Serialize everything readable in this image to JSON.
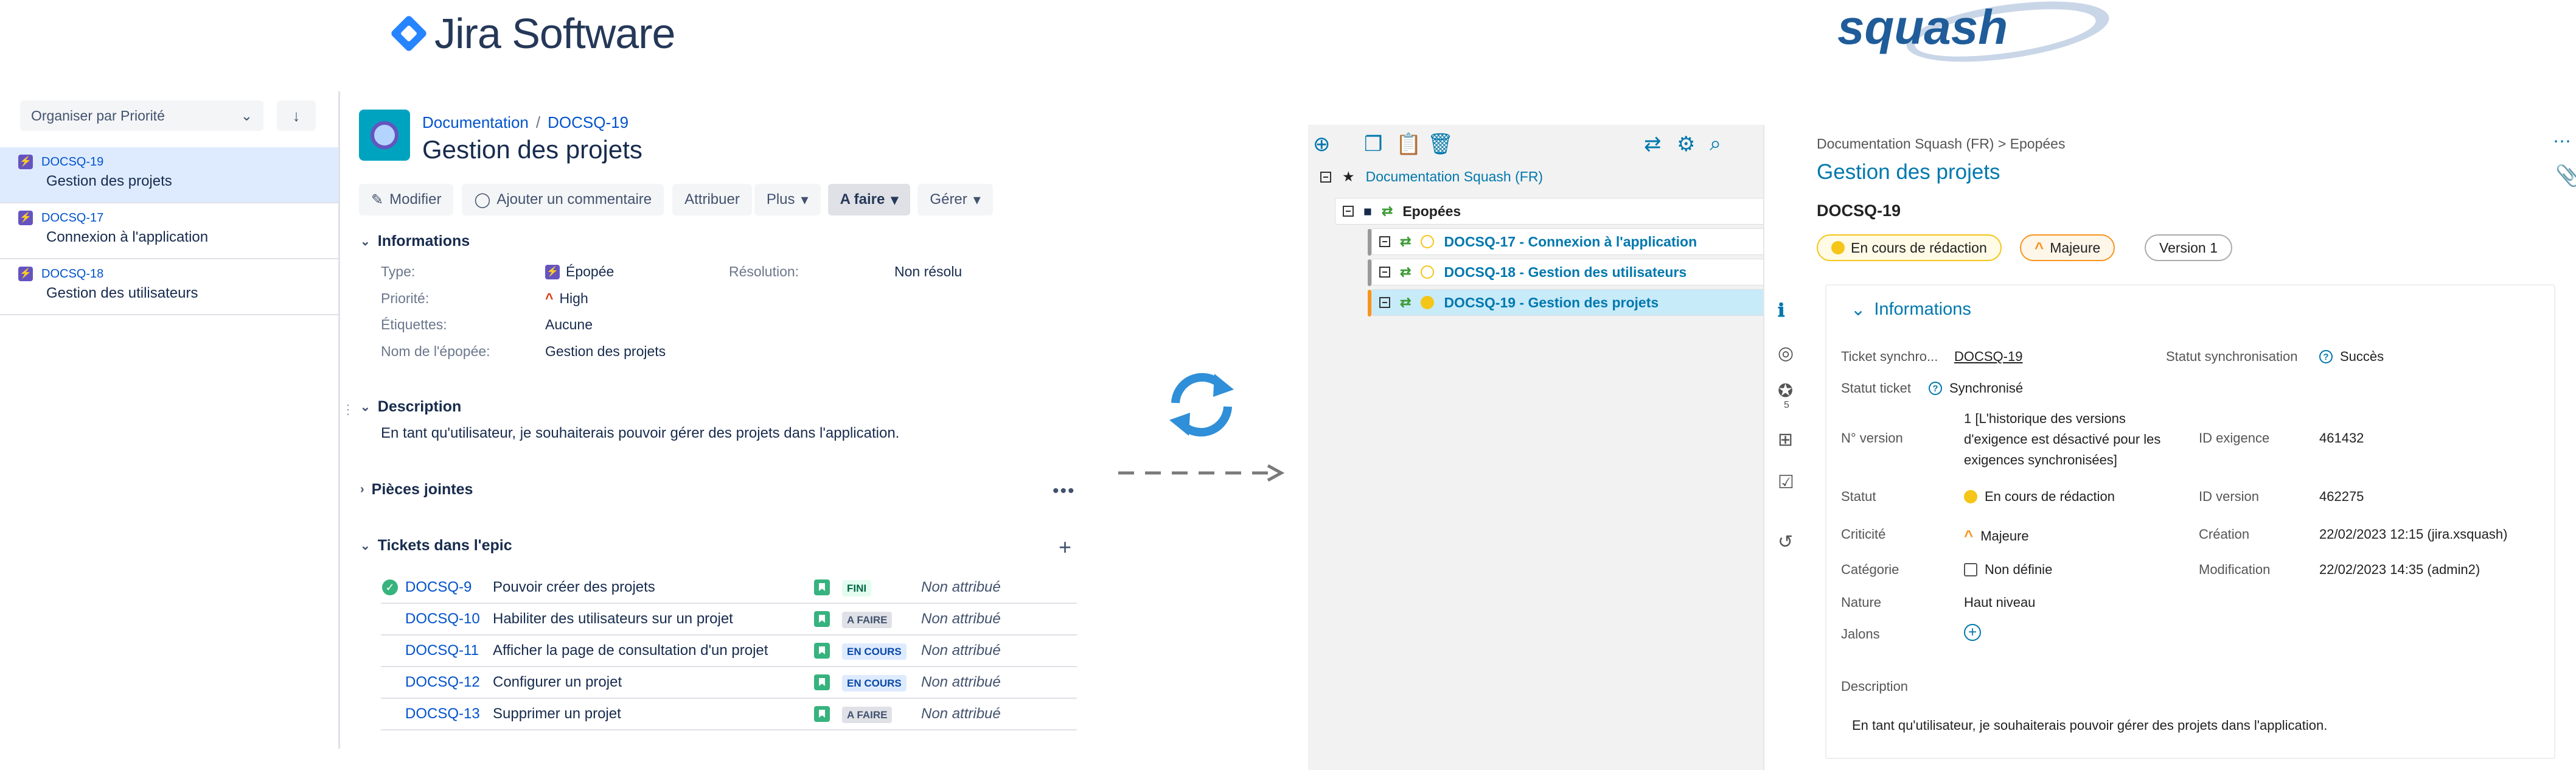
{
  "logos": {
    "jira": "Jira Software",
    "squash": "squash"
  },
  "jira": {
    "sort_label": "Organiser par Priorité",
    "sort_dir_icon": "↓",
    "issues": [
      {
        "key": "DOCSQ-19",
        "summary": "Gestion des projets",
        "selected": true
      },
      {
        "key": "DOCSQ-17",
        "summary": "Connexion à l'application",
        "selected": false
      },
      {
        "key": "DOCSQ-18",
        "summary": "Gestion des utilisateurs",
        "selected": false
      }
    ],
    "breadcrumb": {
      "project": "Documentation",
      "issue": "DOCSQ-19"
    },
    "title": "Gestion des projets",
    "buttons": {
      "modifier": "Modifier",
      "comment": "Ajouter un commentaire",
      "attribuer": "Attribuer",
      "plus": "Plus",
      "status": "A faire",
      "gerer": "Gérer"
    },
    "informations_heading": "Informations",
    "fields": {
      "type_label": "Type:",
      "type_value": "Épopée",
      "resolution_label": "Résolution:",
      "resolution_value": "Non résolu",
      "priority_label": "Priorité:",
      "priority_value": "High",
      "labels_label": "Étiquettes:",
      "labels_value": "Aucune",
      "epic_name_label": "Nom de l'épopée:",
      "epic_name_value": "Gestion des projets"
    },
    "description_heading": "Description",
    "description": "En tant qu'utilisateur, je souhaiterais pouvoir gérer des projets dans l'application.",
    "attachments_heading": "Pièces jointes",
    "epic_tickets_heading": "Tickets dans l'epic",
    "tickets": [
      {
        "key": "DOCSQ-9",
        "summary": "Pouvoir créer des projets",
        "status": "FINI",
        "assignee": "Non attribué",
        "done": true
      },
      {
        "key": "DOCSQ-10",
        "summary": "Habiliter des utilisateurs sur un projet",
        "status": "A FAIRE",
        "assignee": "Non attribué",
        "done": false
      },
      {
        "key": "DOCSQ-11",
        "summary": "Afficher la page de consultation d'un projet",
        "status": "EN COURS",
        "assignee": "Non attribué",
        "done": false
      },
      {
        "key": "DOCSQ-12",
        "summary": "Configurer un projet",
        "status": "EN COURS",
        "assignee": "Non attribué",
        "done": false
      },
      {
        "key": "DOCSQ-13",
        "summary": "Supprimer un projet",
        "status": "A FAIRE",
        "assignee": "Non attribué",
        "done": false
      }
    ],
    "status_colors": {
      "FINI": "#e3fcef",
      "A FAIRE": "#dfe1e6",
      "EN COURS": "#deebff"
    },
    "status_text_colors": {
      "FINI": "#006644",
      "A FAIRE": "#42526e",
      "EN COURS": "#0747a6"
    }
  },
  "squash": {
    "tree": {
      "root": "Documentation Squash (FR)",
      "folder": "Epopées",
      "nodes": [
        {
          "label": "DOCSQ-17 - Connexion à l'application",
          "state": "outline"
        },
        {
          "label": "DOCSQ-18 - Gestion des utilisateurs",
          "state": "outline"
        },
        {
          "label": "DOCSQ-19 - Gestion des projets",
          "state": "fill",
          "selected": true
        }
      ]
    },
    "breadcrumb": "Documentation Squash (FR) > Epopées",
    "title": "Gestion des projets",
    "key": "DOCSQ-19",
    "pills": {
      "status": "En cours de rédaction",
      "criticality": "Majeure",
      "version": "Version 1"
    },
    "info_heading": "Informations",
    "fields": {
      "sync_ticket_label": "Ticket synchro...",
      "sync_ticket_value": "DOCSQ-19",
      "sync_status_label": "Statut synchronisation",
      "sync_status_value": "Succès",
      "ticket_status_label": "Statut ticket",
      "ticket_status_value": "Synchronisé",
      "version_no_label": "N° version",
      "version_no_value": "1 [L'historique des versions d'exigence est désactivé pour les exigences synchronisées]",
      "req_id_label": "ID exigence",
      "req_id_value": "461432",
      "status_label": "Statut",
      "status_value": "En cours de rédaction",
      "version_id_label": "ID version",
      "version_id_value": "462275",
      "criticality_label": "Criticité",
      "criticality_value": "Majeure",
      "created_label": "Création",
      "created_value": "22/02/2023 12:15 (jira.xsquash)",
      "category_label": "Catégorie",
      "category_value": "Non définie",
      "modified_label": "Modification",
      "modified_value": "22/02/2023 14:35 (admin2)",
      "nature_label": "Nature",
      "nature_value": "Haut niveau",
      "milestones_label": "Jalons",
      "description_label": "Description",
      "description_value": "En tant qu'utilisateur, je souhaiterais pouvoir gérer des projets dans l'application."
    },
    "side_count": "5"
  }
}
